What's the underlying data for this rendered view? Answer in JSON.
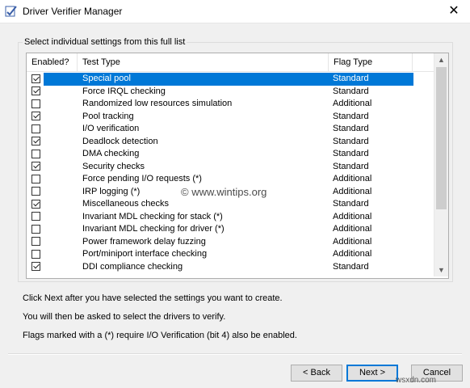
{
  "window": {
    "title": "Driver Verifier Manager",
    "close_glyph": "✕"
  },
  "group": {
    "label": "Select individual settings from this full list"
  },
  "list": {
    "headers": [
      "Enabled?",
      "Test Type",
      "Flag Type"
    ],
    "rows": [
      {
        "checked": true,
        "name": "Special pool",
        "flag": "Standard",
        "selected": true
      },
      {
        "checked": true,
        "name": "Force IRQL checking",
        "flag": "Standard"
      },
      {
        "checked": false,
        "name": "Randomized low resources simulation",
        "flag": "Additional"
      },
      {
        "checked": true,
        "name": "Pool tracking",
        "flag": "Standard"
      },
      {
        "checked": false,
        "name": "I/O verification",
        "flag": "Standard"
      },
      {
        "checked": true,
        "name": "Deadlock detection",
        "flag": "Standard"
      },
      {
        "checked": false,
        "name": "DMA checking",
        "flag": "Standard"
      },
      {
        "checked": true,
        "name": "Security checks",
        "flag": "Standard"
      },
      {
        "checked": false,
        "name": "Force pending I/O requests (*)",
        "flag": "Additional"
      },
      {
        "checked": false,
        "name": "IRP logging (*)",
        "flag": "Additional"
      },
      {
        "checked": true,
        "name": "Miscellaneous checks",
        "flag": "Standard"
      },
      {
        "checked": false,
        "name": "Invariant MDL checking for stack (*)",
        "flag": "Additional"
      },
      {
        "checked": false,
        "name": "Invariant MDL checking for driver (*)",
        "flag": "Additional"
      },
      {
        "checked": false,
        "name": "Power framework delay fuzzing",
        "flag": "Additional"
      },
      {
        "checked": false,
        "name": "Port/miniport interface checking",
        "flag": "Additional"
      },
      {
        "checked": true,
        "name": "DDI compliance checking",
        "flag": "Standard"
      }
    ]
  },
  "info": {
    "line1": "Click Next after you have selected the settings you want to create.",
    "line2": "You will then be asked to select the drivers to verify.",
    "line3": "Flags marked with a (*) require I/O Verification (bit 4) also be enabled."
  },
  "buttons": {
    "back": "< Back",
    "next": "Next >",
    "cancel": "Cancel"
  },
  "watermark": {
    "text": "© www.wintips.org",
    "corner": "wsxdn.com"
  },
  "colors": {
    "selection": "#0078d7",
    "background": "#f0f0f0"
  }
}
